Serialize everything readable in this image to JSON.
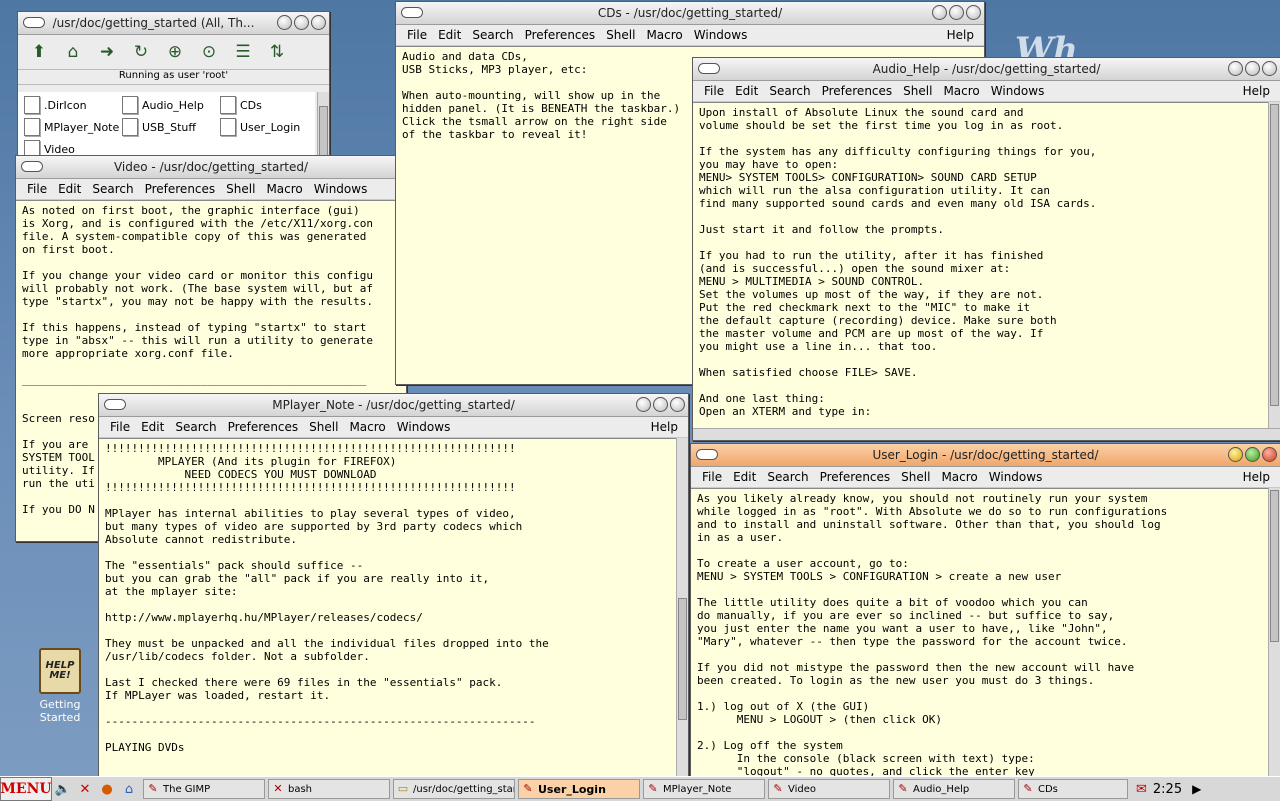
{
  "fm": {
    "title": "/usr/doc/getting_started (All, Th...",
    "status": "Running as user 'root'",
    "files": [
      ".DirIcon",
      "Audio_Help",
      "CDs",
      "MPlayer_Note",
      "USB_Stuff",
      "User_Login",
      "Video"
    ]
  },
  "menus": {
    "file": "File",
    "edit": "Edit",
    "search": "Search",
    "preferences": "Preferences",
    "shell": "Shell",
    "macro": "Macro",
    "windows": "Windows",
    "help": "Help"
  },
  "video": {
    "title": "Video - /usr/doc/getting_started/",
    "text": "As noted on first boot, the graphic interface (gui)\nis Xorg, and is configured with the /etc/X11/xorg.con\nfile. A system-compatible copy of this was generated\non first boot.\n\nIf you change your video card or monitor this configu\nwill probably not work. (The base system will, but af\ntype \"startx\", you may not be happy with the results.\n\nIf this happens, instead of typing \"startx\" to start\ntype in \"absx\" -- this will run a utility to generate\nmore appropriate xorg.conf file.\n\n____________________________________________________\n\n\nScreen reso\n\nIf you are\nSYSTEM TOOL\nutility. If\nrun the uti\n\nIf you DO N"
  },
  "cds": {
    "title": "CDs - /usr/doc/getting_started/",
    "text": "Audio and data CDs,\nUSB Sticks, MP3 player, etc:\n\nWhen auto-mounting, will show up in the\nhidden panel. (It is BENEATH the taskbar.)\nClick the tsmall arrow on the right side\nof the taskbar to reveal it!"
  },
  "audio": {
    "title": "Audio_Help - /usr/doc/getting_started/",
    "text": "Upon install of Absolute Linux the sound card and\nvolume should be set the first time you log in as root.\n\nIf the system has any difficulty configuring things for you,\nyou may have to open:\nMENU> SYSTEM TOOLS> CONFIGURATION> SOUND CARD SETUP\nwhich will run the alsa configuration utility. It can\nfind many supported sound cards and even many old ISA cards.\n\nJust start it and follow the prompts.\n\nIf you had to run the utility, after it has finished\n(and is successful...) open the sound mixer at:\nMENU > MULTIMEDIA > SOUND CONTROL.\nSet the volumes up most of the way, if they are not.\nPut the red checkmark next to the \"MIC\" to make it\nthe default capture (recording) device. Make sure both\nthe master volume and PCM are up most of the way. If\nyou might use a line in... that too.\n\nWhen satisfied choose FILE> SAVE.\n\nAnd one last thing:\nOpen an XTERM and type in:"
  },
  "mplayer": {
    "title": "MPlayer_Note - /usr/doc/getting_started/",
    "text": "!!!!!!!!!!!!!!!!!!!!!!!!!!!!!!!!!!!!!!!!!!!!!!!!!!!!!!!!!!!!!!\n        MPLAYER (And its plugin for FIREFOX)\n            NEED CODECS YOU MUST DOWNLOAD\n!!!!!!!!!!!!!!!!!!!!!!!!!!!!!!!!!!!!!!!!!!!!!!!!!!!!!!!!!!!!!!\n\nMPlayer has internal abilities to play several types of video,\nbut many types of video are supported by 3rd party codecs which\nAbsolute cannot redistribute.\n\nThe \"essentials\" pack should suffice --\nbut you can grab the \"all\" pack if you are really into it,\nat the mplayer site:\n\nhttp://www.mplayerhq.hu/MPlayer/releases/codecs/\n\nThey must be unpacked and all the individual files dropped into the\n/usr/lib/codecs folder. Not a subfolder.\n\nLast I checked there were 69 files in the \"essentials\" pack.\nIf MPLayer was loaded, restart it.\n\n-----------------------------------------------------------------\n\nPLAYING DVDs"
  },
  "user": {
    "title": "User_Login - /usr/doc/getting_started/",
    "text": "As you likely already know, you should not routinely run your system\nwhile logged in as \"root\". With Absolute we do so to run configurations\nand to install and uninstall software. Other than that, you should log\nin as a user.\n\nTo create a user account, go to:\nMENU > SYSTEM TOOLS > CONFIGURATION > create a new user\n\nThe little utility does quite a bit of voodoo which you can\ndo manually, if you are ever so inclined -- but suffice to say,\nyou just enter the name you want a user to have,, like \"John\",\n\"Mary\", whatever -- then type the password for the account twice.\n\nIf you did not mistype the password then the new account will have\nbeen created. To login as the new user you must do 3 things.\n\n1.) log out of X (the GUI)\n      MENU > LOGOUT > (then click OK)\n\n2.) Log off the system\n      In the console (black screen with text) type:\n      \"logout\" - no quotes, and click the enter key"
  },
  "desktop": {
    "brand": "Wh",
    "icon_label": "Getting Started",
    "icon_badge": "HELP ME!"
  },
  "taskbar": {
    "menu": "MENU",
    "tasks": [
      "The GIMP",
      "bash",
      "/usr/doc/getting_star...",
      "User_Login",
      "MPlayer_Note",
      "Video",
      "Audio_Help",
      "CDs"
    ],
    "clock": "2:25"
  }
}
